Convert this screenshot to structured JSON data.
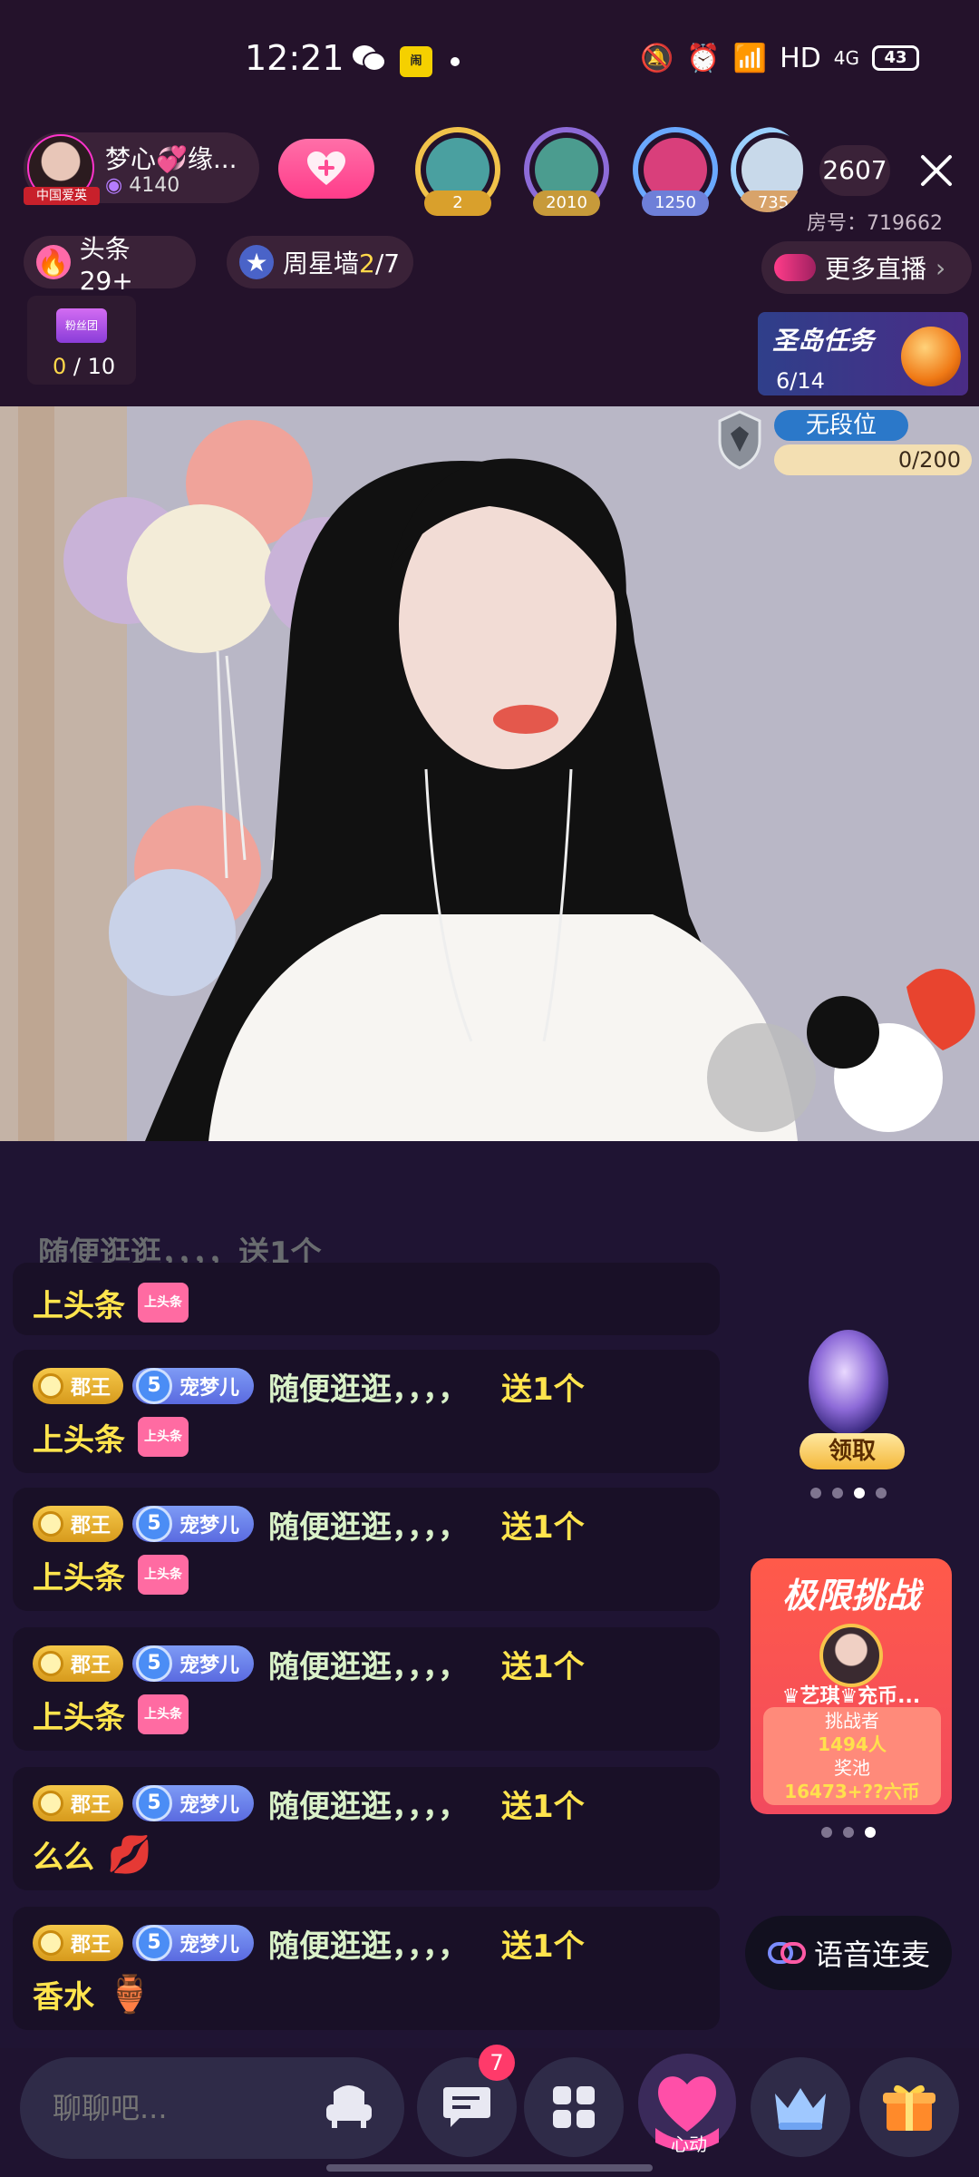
{
  "status_bar": {
    "time": "12:21",
    "network": "HD",
    "signal": "4G",
    "battery": "43"
  },
  "anchor": {
    "name": "梦心💞缘...",
    "heat": "4140",
    "badge": "中国爱英"
  },
  "viewers": [
    {
      "value": "2",
      "ring": "#f1c24a",
      "face": "#4aa0a0"
    },
    {
      "value": "2010",
      "ring": "#8d6bd8",
      "face": "#4b9c8f"
    },
    {
      "value": "1250",
      "ring": "#6aa8ff",
      "face": "#d93f7b"
    },
    {
      "value": "735",
      "ring": "#9ad0ff",
      "face": "#c8d9ea"
    }
  ],
  "viewer_count": "2607",
  "room_number": "房号：719662",
  "pills": {
    "headline": "头条29+",
    "week_star_prefix": "周星墙",
    "week_star_progress": "2",
    "week_star_total": "/7",
    "more_live": "更多直播"
  },
  "task": {
    "progress": "0",
    "total": " / 10",
    "icon_label": "粉丝团"
  },
  "mission": {
    "title": "圣岛任务",
    "progress": "6/14"
  },
  "rank": {
    "label": "无段位",
    "progress": "0/200"
  },
  "chat": {
    "faded_text": "随便逛逛，，，，送1个",
    "faded_gift": "上头条",
    "messages": [
      {
        "rank": "郡王",
        "level": "5",
        "user": "宠梦儿",
        "text": "随便逛逛，，，，",
        "gift_action": "送1个",
        "gift": "上头条",
        "gift_icon": "上头条",
        "gift_color": "#ff6ba2"
      },
      {
        "rank": "郡王",
        "level": "5",
        "user": "宠梦儿",
        "text": "随便逛逛，，，，",
        "gift_action": "送1个",
        "gift": "上头条",
        "gift_icon": "上头条",
        "gift_color": "#ff6ba2"
      },
      {
        "rank": "郡王",
        "level": "5",
        "user": "宠梦儿",
        "text": "随便逛逛，，，，",
        "gift_action": "送1个",
        "gift": "上头条",
        "gift_icon": "上头条",
        "gift_color": "#ff6ba2"
      },
      {
        "rank": "郡王",
        "level": "5",
        "user": "宠梦儿",
        "text": "随便逛逛，，，，",
        "gift_action": "送1个",
        "gift": "么么",
        "gift_icon": "💋",
        "gift_color": "transparent"
      },
      {
        "rank": "郡王",
        "level": "5",
        "user": "宠梦儿",
        "text": "随便逛逛，，，，",
        "gift_action": "送1个",
        "gift": "香水",
        "gift_icon": "🏺",
        "gift_color": "transparent"
      }
    ]
  },
  "claim": {
    "label": "领取"
  },
  "challenge": {
    "title": "极限挑战",
    "name": "♛艺琪♛充币...",
    "line1": "挑战者",
    "line2": "1494人",
    "line3": "奖池",
    "line4": "16473+??六币"
  },
  "voice_link": {
    "label": "语音连麦"
  },
  "bottom": {
    "placeholder": "聊聊吧...",
    "notifications": "7",
    "heart_label": "心动"
  }
}
